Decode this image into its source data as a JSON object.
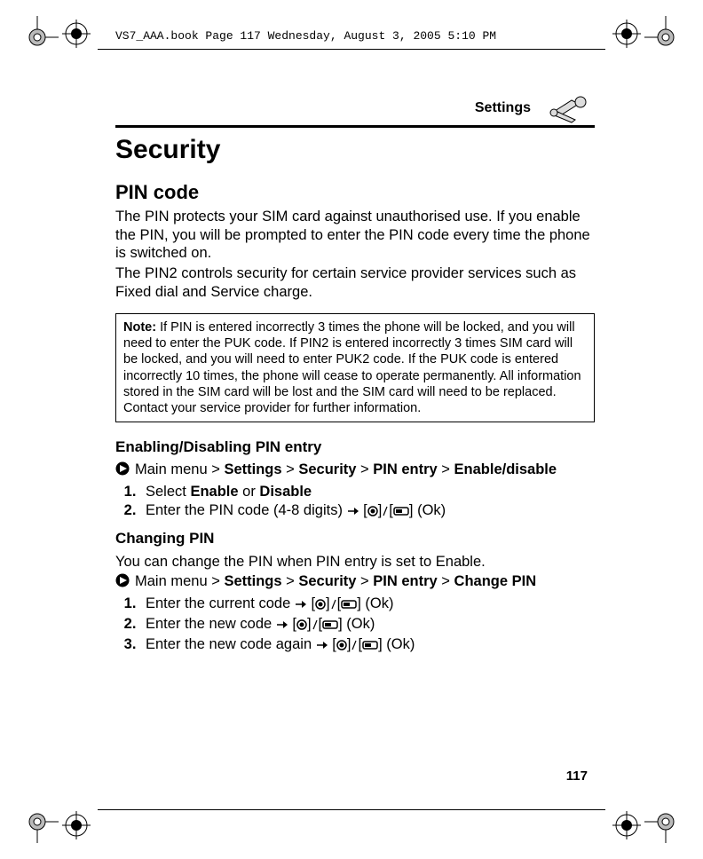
{
  "header": {
    "running_text": "VS7_AAA.book  Page 117  Wednesday, August 3, 2005  5:10 PM"
  },
  "section": {
    "label": "Settings",
    "icon_name": "wrench-icon"
  },
  "title": "Security",
  "pin_code": {
    "heading": "PIN code",
    "para1": "The PIN protects your SIM card against unauthorised use. If you enable the PIN, you will be prompted to enter the PIN code every time the phone is switched on.",
    "para2": "The PIN2 controls security for certain service provider services such as Fixed dial and Service charge."
  },
  "note": {
    "label": "Note:",
    "text": "If PIN is entered incorrectly 3 times the phone will be locked, and you will need to enter the PUK code. If PIN2 is entered incorrectly 3 times SIM card will be locked, and you will need to enter PUK2 code. If the PUK code is entered incorrectly 10 times, the phone will cease to operate permanently. All information stored in the SIM card will be lost and the SIM card will need to be replaced. Contact your service provider for further information."
  },
  "enable_disable": {
    "heading": "Enabling/Disabling PIN entry",
    "breadcrumb": {
      "prefix": "Main menu > ",
      "b1": "Settings",
      "b2": "Security",
      "b3": "PIN entry",
      "b4": "Enable/disable"
    },
    "step1_pre": "Select ",
    "step1_b1": "Enable",
    "step1_mid": " or ",
    "step1_b2": "Disable",
    "step2_pre": "Enter the PIN code (4-8 digits) ",
    "step2_post": " (Ok)"
  },
  "change_pin": {
    "heading": "Changing PIN",
    "intro": "You can change the PIN when PIN entry is set to Enable.",
    "breadcrumb": {
      "prefix": "Main menu > ",
      "b1": "Settings",
      "b2": "Security",
      "b3": "PIN entry",
      "b4": "Change PIN"
    },
    "step1_pre": "Enter the current code ",
    "step_post": " (Ok)",
    "step2_pre": "Enter the new code ",
    "step3_pre": "Enter the new code again "
  },
  "page_number": "117"
}
